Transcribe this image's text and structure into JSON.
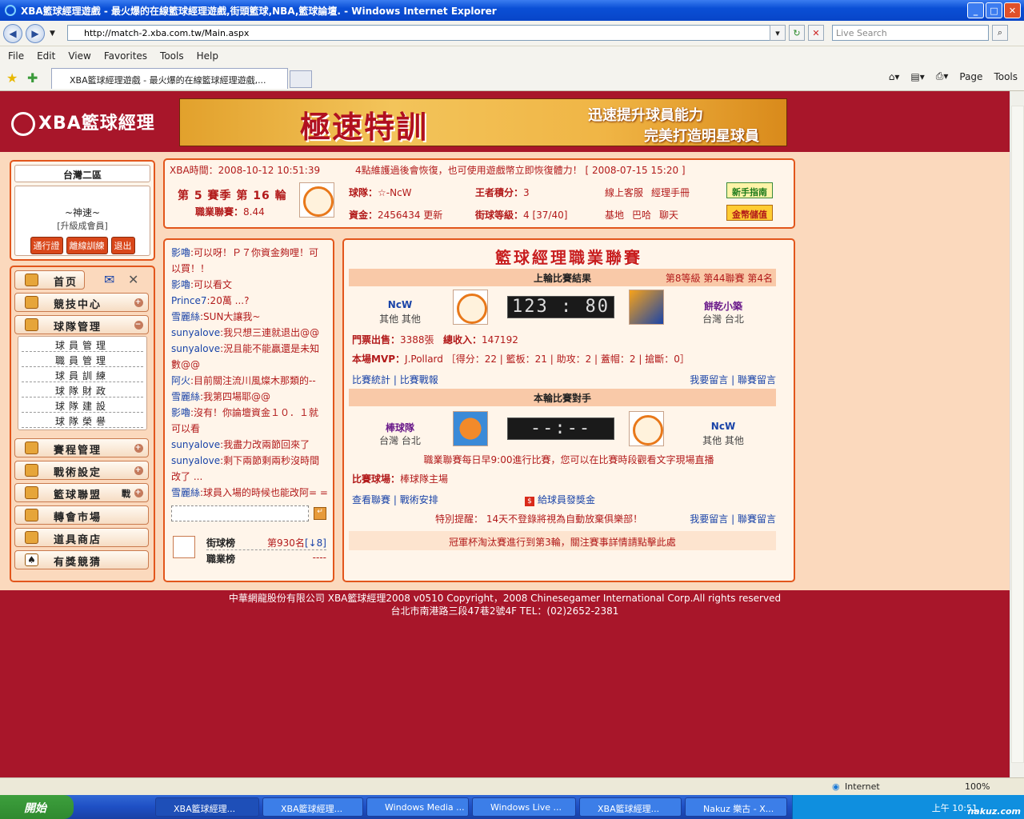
{
  "window": {
    "title": "XBA籃球經理遊戲 - 最火爆的在線籃球經理遊戲,街頭籃球,NBA,籃球論壇. - Windows Internet Explorer"
  },
  "browser": {
    "address": "http://match-2.xba.com.tw/Main.aspx",
    "search_placeholder": "Live Search",
    "menu": [
      "File",
      "Edit",
      "View",
      "Favorites",
      "Tools",
      "Help"
    ],
    "tab_title": "XBA籃球經理遊戲 - 最火爆的在線籃球經理遊戲,...",
    "tools": {
      "page": "Page",
      "tools": "Tools"
    },
    "status_zone": "Internet",
    "zoom": "100%"
  },
  "site": {
    "logo": "XBA籃球經理",
    "banner": {
      "main": "極速特訓",
      "line1": "迅速提升球員能力",
      "line2": "完美打造明星球員"
    }
  },
  "server": "台灣二區",
  "user": {
    "nick": "~神速~",
    "level": "[升級成會員]",
    "buttons": [
      "通行證",
      "離線訓練",
      "退出"
    ]
  },
  "nav": {
    "items": [
      "首页",
      "競技中心",
      "球隊管理",
      "賽程管理",
      "戰術設定",
      "籃球聯盟",
      "轉會市場",
      "道具商店",
      "有獎競猜"
    ],
    "sub": [
      "球員管理",
      "職員管理",
      "球員訓練",
      "球隊財政",
      "球隊建設",
      "球隊榮譽"
    ],
    "league_extra": "戰"
  },
  "info": {
    "time_label": "XBA時間：",
    "time": "2008-10-12 10:51:39",
    "notice": "4點維護過後會恢復，也可使用遊戲幣立即恢復體力！ [ 2008-07-15 15:20 ]",
    "season": "第 5 賽季 第 16 輪",
    "league_label": "職業聯賽：",
    "league_value": "8.44",
    "team_label": "球隊：",
    "team": "☆-NcW",
    "funds_label": "資金：",
    "funds": "2456434",
    "refresh": "更新",
    "king_label": "王者積分：",
    "king": "3",
    "grade_label": "街球等級：",
    "grade": "4 [37/40]",
    "links1": [
      "線上客服",
      "經理手冊"
    ],
    "links2": [
      "基地",
      "巴哈",
      "聊天"
    ],
    "guide": "新手指南",
    "coins": "金幣儲值"
  },
  "chat": [
    {
      "name": "影嚕",
      "text": ":可以呀！Ｐ７你資金夠哩！可以買！！"
    },
    {
      "name": "影嚕",
      "text": ":可以看文"
    },
    {
      "name": "Prince7",
      "text": ":20萬 ...?"
    },
    {
      "name": "雪麗絲",
      "text": ":SUN大讓我~"
    },
    {
      "name": "sunyalove",
      "text": ":我只想三連就退出@@"
    },
    {
      "name": "sunyalove",
      "text": ":況且能不能贏還是未知數@@"
    },
    {
      "name": "阿火",
      "text": ":目前關注流川風燦木那類的--"
    },
    {
      "name": "雪麗絲",
      "text": ":我第四場耶@@"
    },
    {
      "name": "影嚕",
      "text": ":沒有！你論壇資金１０．１就可以看"
    },
    {
      "name": "sunyalove",
      "text": ":我盡力改兩節回來了"
    },
    {
      "name": "sunyalove",
      "text": ":剩下兩節剩兩秒沒時間改了 ..."
    },
    {
      "name": "雪麗絲",
      "text": ":球員入場的時候也能改阿= ="
    }
  ],
  "ranks": [
    {
      "label": "街球榜",
      "value": "第930名",
      "extra": "[↓8]"
    },
    {
      "label": "職業榜",
      "value": "----",
      "extra": ""
    }
  ],
  "league": {
    "title": "籃球經理職業聯賽",
    "last_round": "上輪比賽結果",
    "last_meta": "第8等級 第44聯賽 第4名",
    "home": {
      "name": "NcW",
      "region": "其他 其他"
    },
    "away": {
      "name": "餅乾小築",
      "region": "台灣 台北"
    },
    "score": "123 : 80",
    "tickets_label": "門票出售：",
    "tickets": "3388張",
    "income_label": "總收入：",
    "income": "147192",
    "mvp_label": "本場MVP：",
    "mvp": "J.Pollard ［得分：22 | 籃板：21 | 助攻：2 | 蓋帽：2 | 搶斷：0］",
    "links_left": [
      "比賽統計",
      "比賽戰報"
    ],
    "links_right": [
      "我要留言",
      "聯賽留言"
    ],
    "this_round": "本輪比賽對手",
    "next_home": {
      "name": "棒球隊",
      "region": "台灣 台北"
    },
    "next_away": {
      "name": "NcW",
      "region": "其他 其他"
    },
    "next_score": "--:--",
    "schedule": "職業聯賽每日早9:00進行比賽，您可以在比賽時段觀看文字現場直播",
    "venue_label": "比賽球場：",
    "venue": "棒球隊主場",
    "links2_left": [
      "查看聯賽",
      "戰術安排"
    ],
    "bonus": "給球員發獎金",
    "warn_label": "特別提醒：",
    "warn": "14天不登錄將視為自動放棄俱樂部！",
    "cup": "冠軍杯淘汰賽進行到第3輪，關注賽事詳情請點擊此處"
  },
  "footer": {
    "line1": "中華網龍股份有限公司 XBA籃球經理2008 v0510 Copyright，2008 Chinesegamer International Corp.All rights reserved",
    "line2": "台北市南港路三段47巷2號4F TEL：(02)2652-2381"
  },
  "taskbar": {
    "start": "開始",
    "buttons": [
      "XBA籃球經理...",
      "XBA籃球經理...",
      "Windows Media ...",
      "Windows Live ...",
      "XBA籃球經理...",
      "Nakuz 樂古 - X..."
    ],
    "clock": "上午 10:51",
    "watermark": "nakuz.com"
  }
}
